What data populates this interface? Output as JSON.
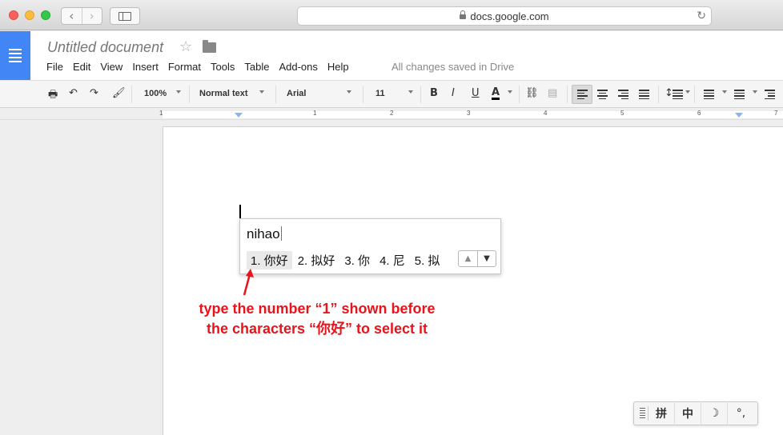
{
  "browser": {
    "url": "docs.google.com",
    "back_icon": "‹",
    "forward_icon": "›",
    "reload_icon": "↻"
  },
  "doc": {
    "title": "Untitled document",
    "star_icon": "☆",
    "menu": [
      "File",
      "Edit",
      "View",
      "Insert",
      "Format",
      "Tools",
      "Table",
      "Add-ons",
      "Help"
    ],
    "save_status": "All changes saved in Drive"
  },
  "toolbar": {
    "zoom": "100%",
    "style": "Normal text",
    "font": "Arial",
    "size": "11",
    "bold": "B",
    "italic": "I",
    "underline": "U",
    "text_color": "A"
  },
  "ruler": {
    "numbers": [
      "1",
      "1",
      "2",
      "3",
      "4",
      "5",
      "6",
      "7"
    ]
  },
  "ime": {
    "input": "nihao",
    "candidates": [
      "1. 你好",
      "2. 拟好",
      "3. 你",
      "4. 尼",
      "5. 拟"
    ],
    "selected_index": 0
  },
  "annotation": {
    "line1": "type the number “1” shown before",
    "line2": "the characters “你好” to select it",
    "color": "#e8141b"
  },
  "ime_bar": {
    "items": [
      "拼",
      "中",
      "☽",
      "°,"
    ]
  },
  "colors": {
    "docs_blue": "#4285f4",
    "annotation_red": "#e8141b"
  }
}
